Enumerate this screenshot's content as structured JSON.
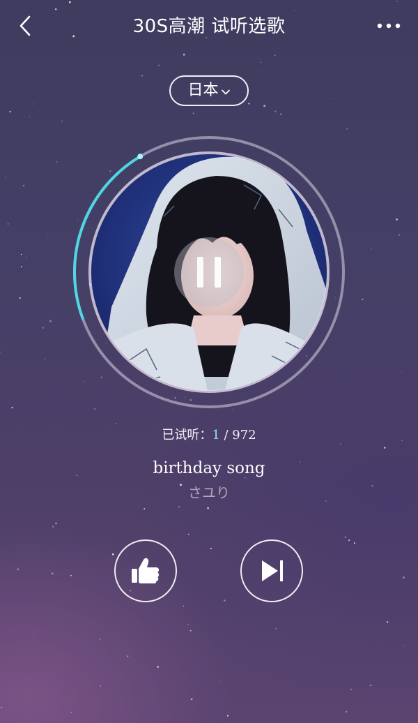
{
  "header": {
    "title": "30S高潮 试听选歌",
    "back_icon": "chevron-left-icon",
    "more_icon": "more-dots-icon"
  },
  "region": {
    "label": "日本",
    "icon": "chevron-down-icon"
  },
  "player": {
    "state": "playing",
    "pause_icon": "pause-icon",
    "progress": 0.22,
    "accent_color": "#4fd6e3",
    "listened_label": "已试听：",
    "listened_count": "1",
    "separator": " / ",
    "total": "972"
  },
  "song": {
    "title": "birthday song",
    "artist": "さユり"
  },
  "actions": {
    "like_icon": "thumbs-up-icon",
    "next_icon": "skip-next-icon"
  }
}
